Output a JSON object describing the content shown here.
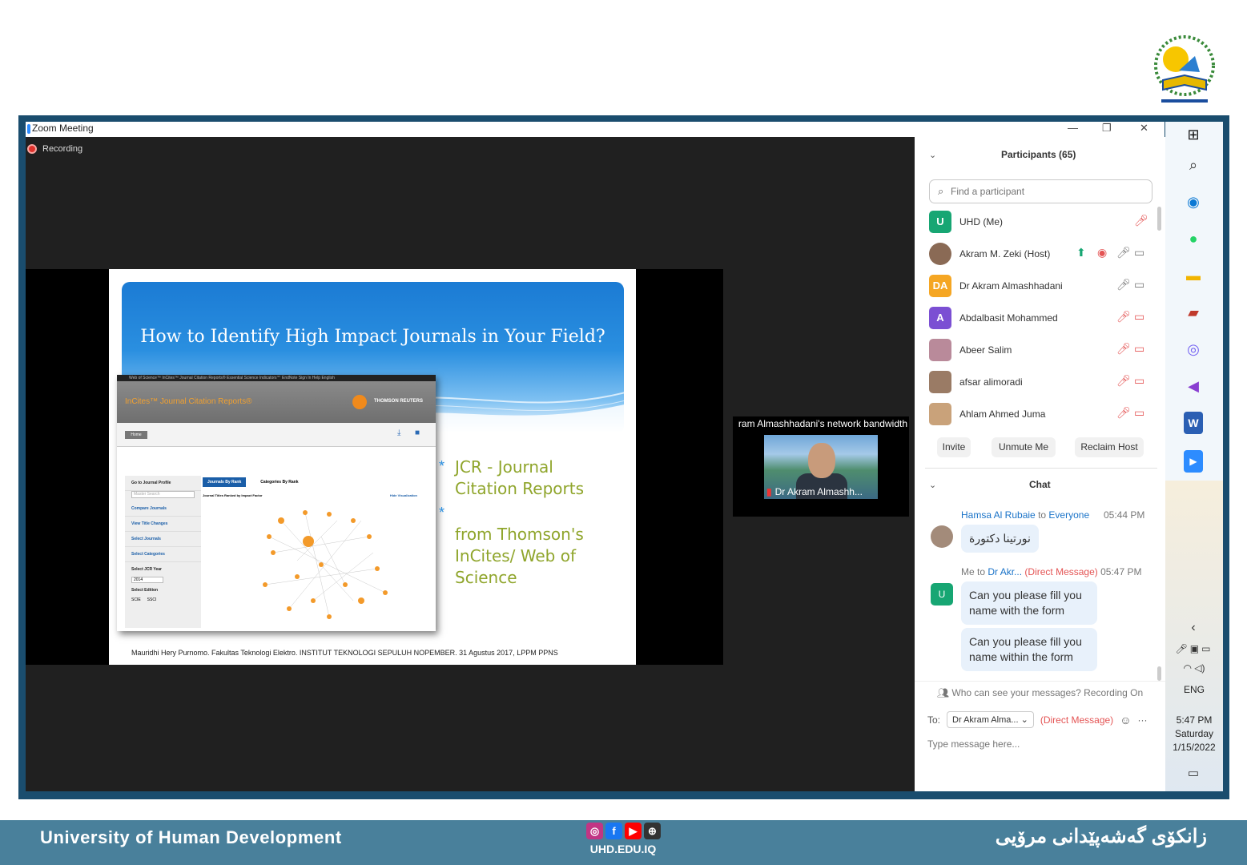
{
  "window": {
    "title": "Zoom Meeting",
    "recording": "Recording"
  },
  "slide": {
    "title": "How to Identify High Impact Journals in Your Field?",
    "jcr": {
      "nav": "Web of Science™   InCites™   Journal Citation Reports®   Essential Science Indicators℠   EndNote   Sign In   Help   English",
      "brand": "InCites™ Journal Citation Reports®",
      "vendor": "THOMSON REUTERS",
      "home": "Home",
      "tab1": "Journals By Rank",
      "tab2": "Categories By Rank",
      "subtitle": "Journal Titles Ranked by Impact Factor",
      "hide": "Hide Visualization",
      "side": [
        "Go to Journal Profile",
        "Compare Journals",
        "View Title Changes",
        "Select Journals",
        "Select Categories",
        "Select JCR Year",
        "Select Edition"
      ],
      "search_ph": "Master Search",
      "year": "2014",
      "scie": "SCIE",
      "ssci": "SSCI"
    },
    "bullet1": "JCR - Journal Citation Reports",
    "bullet2": "from Thomson's InCites/ Web of Science",
    "credit": "Mauridhi Hery Purnomo. Fakultas Teknologi Elektro. INSTITUT TEKNOLOGI SEPULUH NOPEMBER. 31 Agustus 2017, LPPM PPNS"
  },
  "video": {
    "bandwidth": "ram Almashhadani's network bandwidth",
    "name": "Dr Akram Almashh..."
  },
  "participants": {
    "header": "Participants (65)",
    "search_placeholder": "Find a participant",
    "list": [
      {
        "initials": "U",
        "name": "UHD (Me)",
        "color": "#17a673"
      },
      {
        "initials": "",
        "name": "Akram M. Zeki (Host)",
        "color": "#8a6a55"
      },
      {
        "initials": "DA",
        "name": "Dr Akram Almashhadani",
        "color": "#f5a623"
      },
      {
        "initials": "A",
        "name": "Abdalbasit Mohammed",
        "color": "#7b4fd3"
      },
      {
        "initials": "",
        "name": "Abeer Salim",
        "color": "#b98a9a"
      },
      {
        "initials": "",
        "name": "afsar alimoradi",
        "color": "#9a7b65"
      },
      {
        "initials": "",
        "name": "Ahlam Ahmed Juma",
        "color": "#c9a27a"
      }
    ],
    "invite": "Invite",
    "unmute": "Unmute Me",
    "reclaim": "Reclaim Host"
  },
  "chat": {
    "header": "Chat",
    "msg1": {
      "from": "Hamsa Al Rubaie",
      "to_word": "to",
      "to": "Everyone",
      "time": "05:44 PM",
      "text": "نورتينا دكتورة"
    },
    "msg2": {
      "from": "Me",
      "to_word": "to",
      "to": "Dr Akr...",
      "direct": "(Direct Message)",
      "time": "05:47 PM",
      "avatar": "U",
      "bubbles": [
        "Can you please fill you name with the form",
        "Can you please fill you name within the form"
      ]
    },
    "who": "Who can see your messages? Recording On",
    "to_label": "To:",
    "to_value": "Dr Akram Alma...",
    "to_direct": "(Direct Message)",
    "input_placeholder": "Type message here..."
  },
  "taskbar": {
    "lang": "ENG",
    "time": "5:47 PM",
    "day": "Saturday",
    "date": "1/15/2022"
  },
  "footer": {
    "left": "University of Human Development",
    "right": "زانکۆی گەشەپێدانی مرۆیی",
    "web": "UHD.EDU.IQ"
  }
}
